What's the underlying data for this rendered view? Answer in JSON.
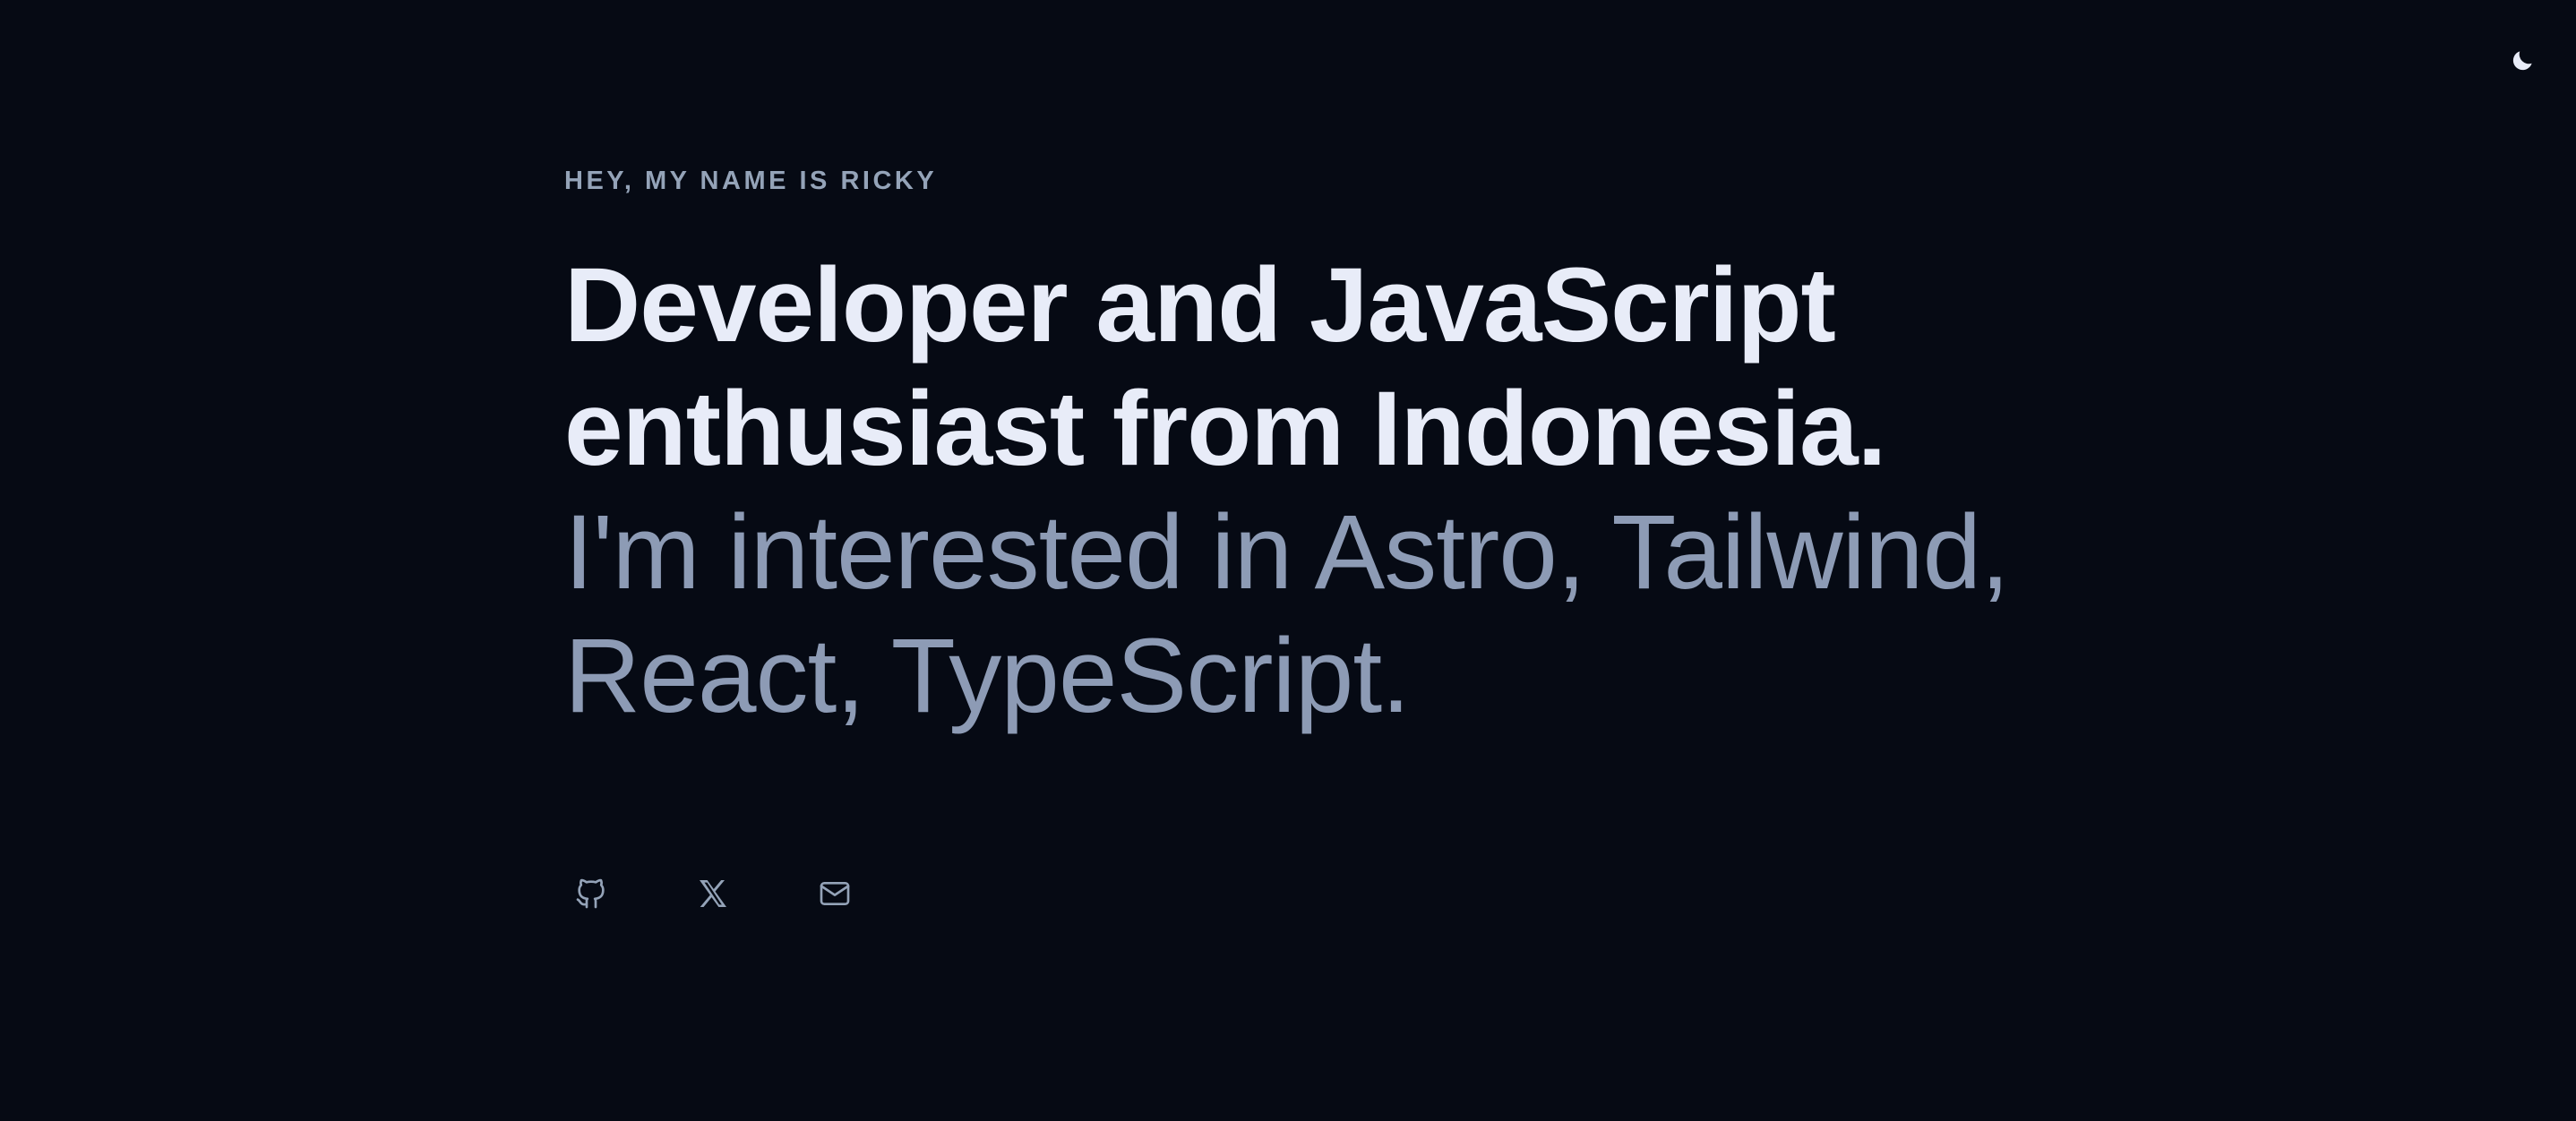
{
  "header": {
    "theme_toggle_icon": "moon-icon"
  },
  "hero": {
    "eyebrow": "HEY, MY NAME IS RICKY",
    "headline_strong": "Developer and JavaScript enthusiast from Indonesia.",
    "headline_muted": "I'm interested in Astro, Tailwind, React, TypeScript."
  },
  "socials": [
    {
      "icon": "github-icon"
    },
    {
      "icon": "x-icon"
    },
    {
      "icon": "mail-icon"
    }
  ],
  "colors": {
    "background": "#060a14",
    "headline_strong": "#e8ecf8",
    "headline_muted": "#8d9bb5",
    "eyebrow": "#94a3b8",
    "icon": "#94a3b8"
  }
}
